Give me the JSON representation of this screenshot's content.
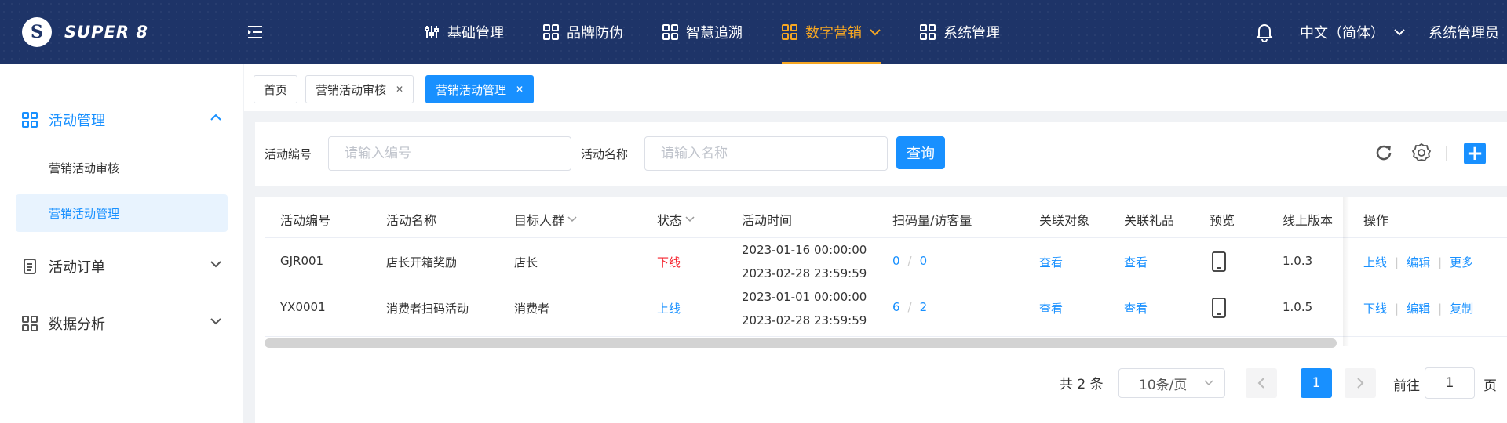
{
  "app": {
    "logo_letter": "S",
    "logo_text": "SUPER 8"
  },
  "nav": {
    "items": [
      {
        "label": "基础管理",
        "icon": "sliders-icon"
      },
      {
        "label": "品牌防伪",
        "icon": "grid-icon"
      },
      {
        "label": "智慧追溯",
        "icon": "grid-icon"
      },
      {
        "label": "数字营销",
        "icon": "grid-icon",
        "active": true
      },
      {
        "label": "系统管理",
        "icon": "grid-icon"
      }
    ],
    "active_color": "#f5a623",
    "language": "中文（简体）",
    "user": "系统管理员"
  },
  "sidebar": {
    "groups": [
      {
        "label": "活动管理",
        "open": true,
        "items": [
          "营销活动审核",
          "营销活动管理"
        ],
        "active_item": "营销活动管理"
      },
      {
        "label": "活动订单",
        "open": false
      },
      {
        "label": "数据分析",
        "open": false
      }
    ]
  },
  "tabs": [
    {
      "label": "首页",
      "closable": false
    },
    {
      "label": "营销活动审核",
      "closable": true
    },
    {
      "label": "营销活动管理",
      "closable": true,
      "active": true
    }
  ],
  "search": {
    "code_label": "活动编号",
    "code_placeholder": "请输入编号",
    "name_label": "活动名称",
    "name_placeholder": "请输入名称",
    "query_label": "查询",
    "add_label": "+"
  },
  "table": {
    "columns": [
      "活动编号",
      "活动名称",
      "目标人群",
      "状态",
      "活动时间",
      "扫码量/访客量",
      "关联对象",
      "关联礼品",
      "预览",
      "线上版本",
      "操作"
    ],
    "rows": [
      {
        "code": "GJR001",
        "name": "店长开箱奖励",
        "target": "店长",
        "status": "下线",
        "start": "2023-01-16 00:00:00",
        "end": "2023-02-28 23:59:59",
        "scans": "0",
        "visitors": "0",
        "obj": "查看",
        "gift": "查看",
        "version": "1.0.3",
        "ops": [
          "上线",
          "编辑",
          "更多"
        ]
      },
      {
        "code": "YX0001",
        "name": "消费者扫码活动",
        "target": "消费者",
        "status": "上线",
        "start": "2023-01-01 00:00:00",
        "end": "2023-02-28 23:59:59",
        "scans": "6",
        "visitors": "2",
        "obj": "查看",
        "gift": "查看",
        "version": "1.0.5",
        "ops": [
          "下线",
          "编辑",
          "复制"
        ]
      }
    ],
    "slash": "/",
    "op_sep": "|"
  },
  "pagination": {
    "total_text": "共 2 条",
    "page_size": "10条/页",
    "current_page": "1",
    "goto_prefix": "前往",
    "goto_value": "1",
    "goto_suffix": "页"
  },
  "colors": {
    "primary": "#1890ff",
    "header_bg": "#1e3468",
    "offline_red": "#f5222d"
  }
}
